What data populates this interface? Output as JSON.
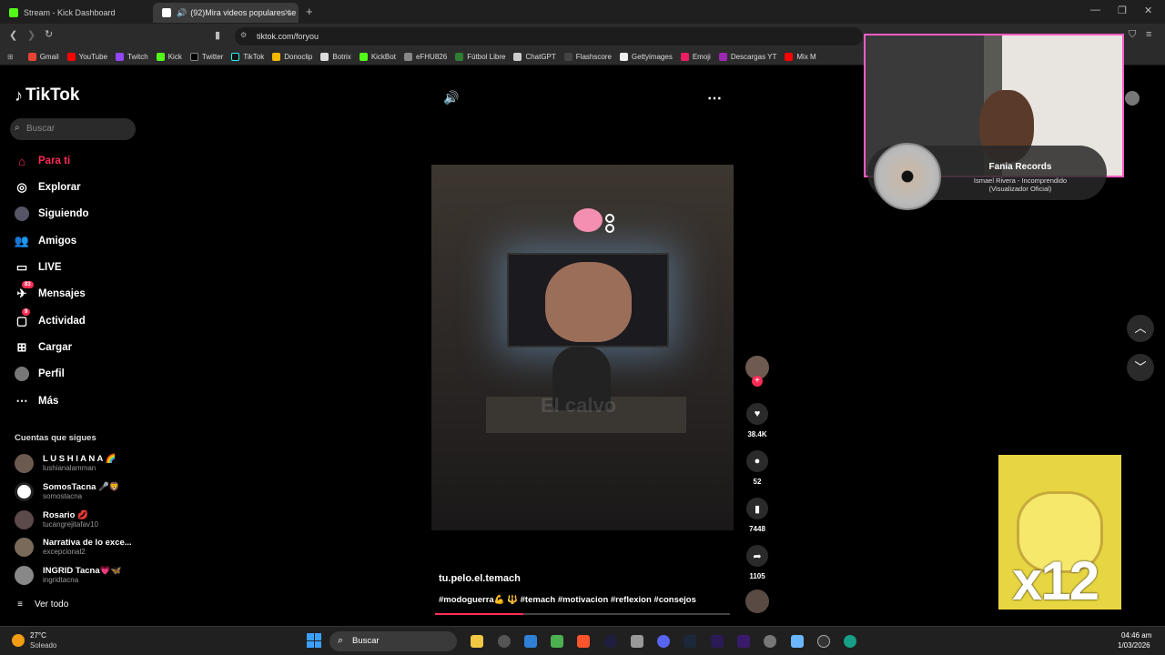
{
  "browser": {
    "tabs": [
      {
        "label": "Stream - Kick Dashboard"
      },
      {
        "label": "(92)Mira videos populares se"
      }
    ],
    "url": "tiktok.com/foryou",
    "bookmarks": [
      "Gmail",
      "YouTube",
      "Twitch",
      "Kick",
      "Twitter",
      "TikTok",
      "Donoclip",
      "Botrix",
      "KickBot",
      "eFHU826",
      "Fútbol Libre",
      "ChatGPT",
      "Flashscore",
      "Gettyimages",
      "Emoji",
      "Descargas YT",
      "Mix M"
    ]
  },
  "sidebar": {
    "logo": "TikTok",
    "search_placeholder": "Buscar",
    "nav": [
      {
        "label": "Para ti"
      },
      {
        "label": "Explorar"
      },
      {
        "label": "Siguiendo"
      },
      {
        "label": "Amigos"
      },
      {
        "label": "LIVE"
      },
      {
        "label": "Mensajes",
        "badge": "83"
      },
      {
        "label": "Actividad",
        "badge": "9"
      },
      {
        "label": "Cargar"
      },
      {
        "label": "Perfil"
      },
      {
        "label": "Más"
      }
    ],
    "following_title": "Cuentas que sigues",
    "accounts": [
      {
        "name": "L U S H I A N A 🌈",
        "handle": "lushianalamman"
      },
      {
        "name": "SomosTacna 🎤🦁",
        "handle": "somostacna"
      },
      {
        "name": "Rosario 💋",
        "handle": "tucangrejitafav10"
      },
      {
        "name": "Narrativa de lo exce...",
        "handle": "excepcional2"
      },
      {
        "name": "INGRID Tacna💗🦋",
        "handle": "ingridtacna"
      }
    ],
    "see_all": "Ver todo"
  },
  "video": {
    "watermark": "El calvo",
    "author": "tu.pelo.el.temach",
    "caption": "#modoguerra💪 🔱 #temach #motivacion #reflexion #consejos",
    "progress": 0.3
  },
  "actions": {
    "likes": "38.4K",
    "comments": "52",
    "saves": "7448",
    "shares": "1105"
  },
  "overlay": {
    "music_title": "Fania Records",
    "music_sub1": "Ismael Rivera - Incomprendido",
    "music_sub2": "(Visualizador Oficial)",
    "meme_text": "x12"
  },
  "taskbar": {
    "temp": "27°C",
    "weather": "Soleado",
    "search": "Buscar",
    "time": "04:46 am",
    "date": "1/03/2026"
  }
}
